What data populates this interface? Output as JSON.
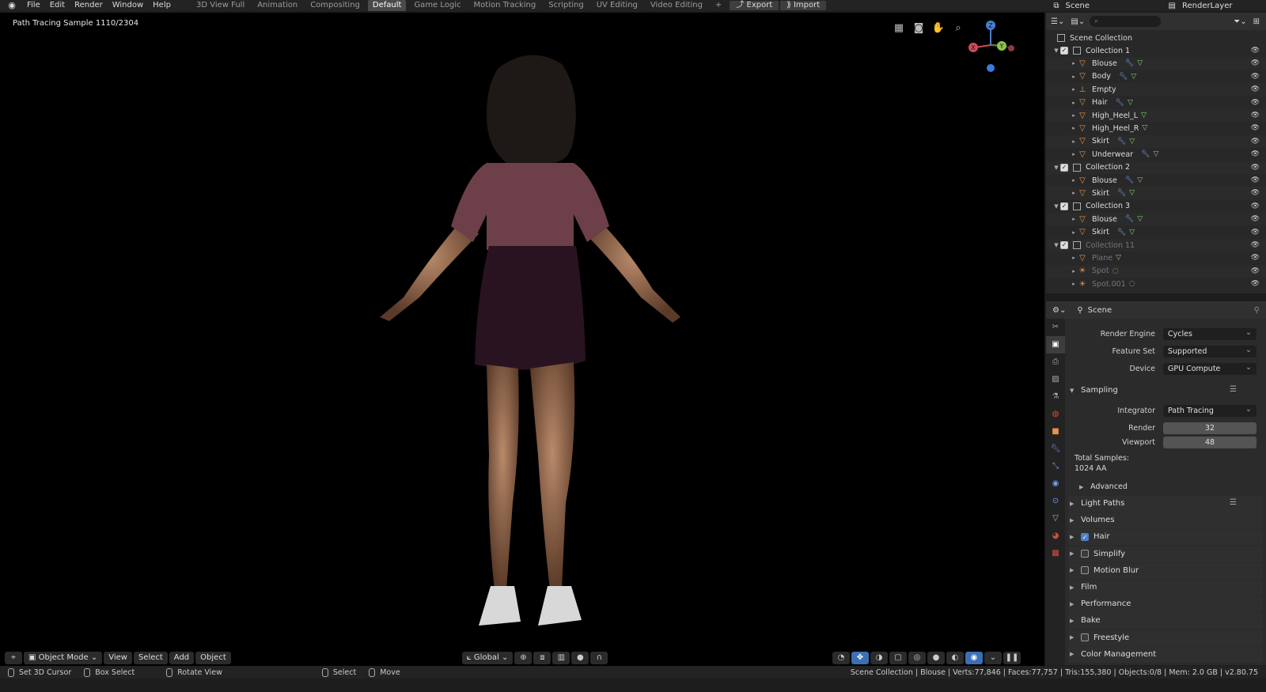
{
  "menu": {
    "items": [
      "File",
      "Edit",
      "Render",
      "Window",
      "Help"
    ]
  },
  "workspaces": [
    {
      "label": "3D View Full",
      "active": false
    },
    {
      "label": "Animation",
      "active": false
    },
    {
      "label": "Compositing",
      "active": false
    },
    {
      "label": "Default",
      "active": true
    },
    {
      "label": "Game Logic",
      "active": false
    },
    {
      "label": "Motion Tracking",
      "active": false
    },
    {
      "label": "Scripting",
      "active": false
    },
    {
      "label": "UV Editing",
      "active": false
    },
    {
      "label": "Video Editing",
      "active": false
    }
  ],
  "topbar": {
    "add_tab": "+",
    "export_label": "Export",
    "import_label": "Import",
    "scene_name": "Scene",
    "layer_name": "RenderLayer"
  },
  "viewport": {
    "info_text": "Path Tracing Sample 1110/2304",
    "gizmo": {
      "z": "Z",
      "x": "X",
      "y": "Y"
    }
  },
  "vp_header": {
    "mode": "Object Mode",
    "view": "View",
    "select": "Select",
    "add": "Add",
    "object": "Object",
    "orientation": "Global"
  },
  "outliner": {
    "search_placeholder": "",
    "root": "Scene Collection",
    "rows": [
      {
        "name": "Collection 1",
        "type": "collection",
        "indent": 0,
        "dim": false,
        "mod": false
      },
      {
        "name": "Blouse",
        "type": "mesh",
        "indent": 1,
        "dim": false,
        "mod": true
      },
      {
        "name": "Body",
        "type": "mesh",
        "indent": 1,
        "dim": false,
        "mod": true
      },
      {
        "name": "Empty",
        "type": "empty",
        "indent": 1,
        "dim": false,
        "mod": false
      },
      {
        "name": "Hair",
        "type": "mesh",
        "indent": 1,
        "dim": false,
        "mod": true
      },
      {
        "name": "High_Heel_L",
        "type": "mesh",
        "indent": 1,
        "dim": false,
        "mod": false
      },
      {
        "name": "High_Heel_R",
        "type": "mesh",
        "indent": 1,
        "dim": false,
        "mod": false
      },
      {
        "name": "Skirt",
        "type": "mesh",
        "indent": 1,
        "dim": false,
        "mod": true
      },
      {
        "name": "Underwear",
        "type": "mesh",
        "indent": 1,
        "dim": false,
        "mod": true
      },
      {
        "name": "Collection 2",
        "type": "collection",
        "indent": 0,
        "dim": false,
        "mod": false
      },
      {
        "name": "Blouse",
        "type": "mesh",
        "indent": 1,
        "dim": false,
        "mod": true
      },
      {
        "name": "Skirt",
        "type": "mesh",
        "indent": 1,
        "dim": false,
        "mod": true
      },
      {
        "name": "Collection 3",
        "type": "collection",
        "indent": 0,
        "dim": false,
        "mod": false
      },
      {
        "name": "Blouse",
        "type": "mesh",
        "indent": 1,
        "dim": false,
        "mod": true
      },
      {
        "name": "Skirt",
        "type": "mesh",
        "indent": 1,
        "dim": false,
        "mod": true
      },
      {
        "name": "Collection 11",
        "type": "collection",
        "indent": 0,
        "dim": true,
        "mod": false
      },
      {
        "name": "Plane",
        "type": "mesh",
        "indent": 1,
        "dim": true,
        "mod": false
      },
      {
        "name": "Spot",
        "type": "light",
        "indent": 1,
        "dim": true,
        "mod": false
      },
      {
        "name": "Spot.001",
        "type": "light",
        "indent": 1,
        "dim": true,
        "mod": false
      }
    ]
  },
  "properties": {
    "context": "Scene",
    "render_engine": {
      "label": "Render Engine",
      "value": "Cycles"
    },
    "feature_set": {
      "label": "Feature Set",
      "value": "Supported"
    },
    "device": {
      "label": "Device",
      "value": "GPU Compute"
    },
    "sampling": {
      "title": "Sampling",
      "integrator_label": "Integrator",
      "integrator": "Path Tracing",
      "render_label": "Render",
      "render": "32",
      "viewport_label": "Viewport",
      "viewport": "48",
      "total_label": "Total Samples:",
      "total_value": "1024 AA",
      "advanced": "Advanced"
    },
    "panels": [
      {
        "label": "Light Paths",
        "check": null
      },
      {
        "label": "Volumes",
        "check": null
      },
      {
        "label": "Hair",
        "check": true
      },
      {
        "label": "Simplify",
        "check": false
      },
      {
        "label": "Motion Blur",
        "check": false
      },
      {
        "label": "Film",
        "check": null
      },
      {
        "label": "Performance",
        "check": null
      },
      {
        "label": "Bake",
        "check": null
      },
      {
        "label": "Freestyle",
        "check": false
      },
      {
        "label": "Color Management",
        "check": null
      }
    ]
  },
  "statusbar": {
    "set_cursor": "Set 3D Cursor",
    "box_select": "Box Select",
    "rotate": "Rotate View",
    "select": "Select",
    "move": "Move",
    "stats": "Scene Collection | Blouse | Verts:77,846 | Faces:77,757 | Tris:155,380 | Objects:0/8 | Mem: 2.0 GB | v2.80.75"
  },
  "colors": {
    "accent": "#4d7fc4",
    "object_icon": "#e8934a",
    "modifier_icon": "#6ea0e8",
    "mesh_data_icon": "#7fd46e"
  }
}
